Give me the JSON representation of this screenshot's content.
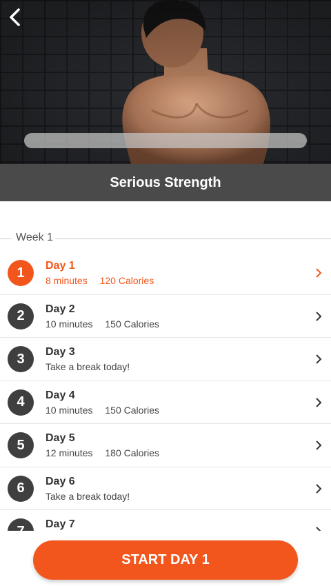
{
  "header": {
    "back_icon": "chevron-left-icon",
    "title": "Serious Strength",
    "progress_fraction": 0
  },
  "week": {
    "label": "Week 1"
  },
  "days": [
    {
      "number": "1",
      "title": "Day 1",
      "duration": "8 minutes",
      "calories": "120 Calories",
      "active": true
    },
    {
      "number": "2",
      "title": "Day 2",
      "duration": "10 minutes",
      "calories": "150 Calories",
      "active": false
    },
    {
      "number": "3",
      "title": "Day 3",
      "rest_text": "Take a break today!",
      "active": false
    },
    {
      "number": "4",
      "title": "Day 4",
      "duration": "10 minutes",
      "calories": "150 Calories",
      "active": false
    },
    {
      "number": "5",
      "title": "Day 5",
      "duration": "12 minutes",
      "calories": "180 Calories",
      "active": false
    },
    {
      "number": "6",
      "title": "Day 6",
      "rest_text": "Take a break today!",
      "active": false
    },
    {
      "number": "7",
      "title": "Day 7",
      "active": false
    }
  ],
  "footer": {
    "start_label": "START DAY 1"
  },
  "colors": {
    "accent": "#f2561d",
    "dark": "#3f3f3f",
    "title_bar": "#4a4a4a"
  }
}
